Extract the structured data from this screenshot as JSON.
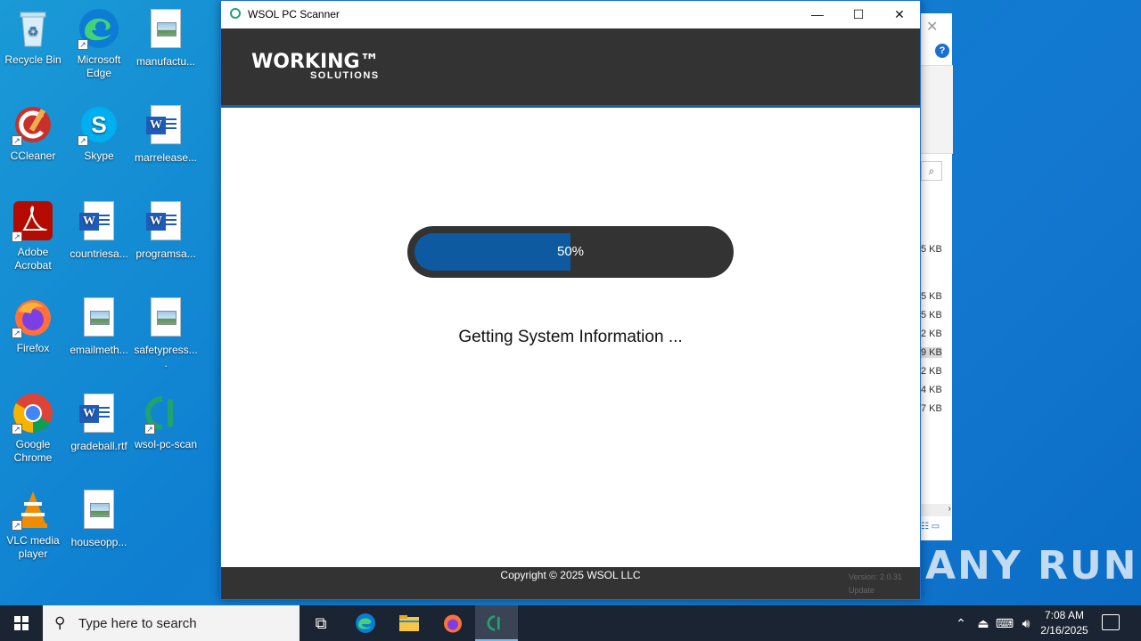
{
  "desktop": {
    "icons": [
      {
        "label": "Recycle Bin"
      },
      {
        "label": "Microsoft Edge"
      },
      {
        "label": "manufactu..."
      },
      {
        "label": "CCleaner"
      },
      {
        "label": "Skype"
      },
      {
        "label": "marrelease..."
      },
      {
        "label": "Adobe Acrobat"
      },
      {
        "label": "countriesa..."
      },
      {
        "label": "programsa..."
      },
      {
        "label": "Firefox"
      },
      {
        "label": "emailmeth..."
      },
      {
        "label": "safetypress...."
      },
      {
        "label": "Google Chrome"
      },
      {
        "label": "gradeball.rtf"
      },
      {
        "label": "wsol-pc-scan"
      },
      {
        "label": "VLC media player"
      },
      {
        "label": "houseopp..."
      }
    ]
  },
  "background_window": {
    "sizes": [
      "5 KB",
      "5 KB",
      "5 KB",
      "2 KB",
      "9 KB",
      "2 KB",
      "4 KB",
      "7 KB"
    ]
  },
  "app": {
    "title": "WSOL PC Scanner",
    "logo_line1": "WORKING™",
    "logo_line2": "SOLUTIONS",
    "progress_percent": 50,
    "progress_label": "50%",
    "status_text": "Getting System Information ...",
    "copyright": "Copyright © 2025 WSOL LLC",
    "version": "Version: 2.0.31",
    "update": "Update",
    "accent": "#0e5aa0"
  },
  "taskbar": {
    "search_placeholder": "Type here to search",
    "time": "7:08 AM",
    "date": "2/16/2025"
  },
  "watermark": "ANY RUN"
}
